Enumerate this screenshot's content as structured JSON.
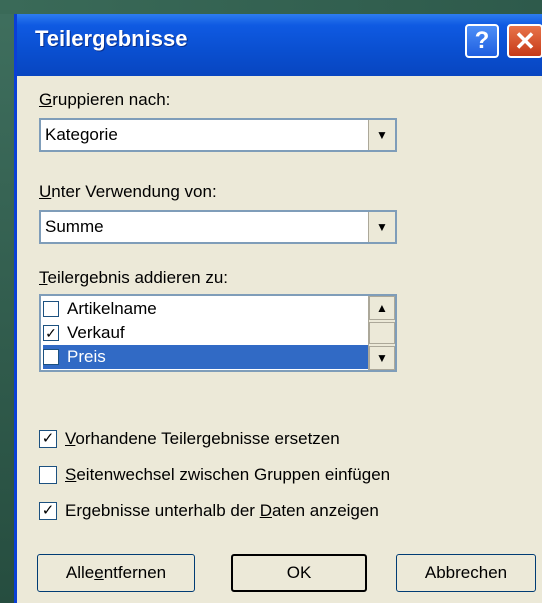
{
  "dialog": {
    "title": "Teilergebnisse",
    "help_label": "?",
    "close_label": "✕"
  },
  "group_by": {
    "label_u": "G",
    "label_rest": "ruppieren nach:",
    "value": "Kategorie"
  },
  "use_function": {
    "label_u": "U",
    "label_rest": "nter Verwendung von:",
    "value": "Summe"
  },
  "add_to": {
    "label_u": "T",
    "label_rest": "eilergebnis addieren zu:",
    "items": [
      {
        "label": "Artikelname",
        "checked": false,
        "mark": ""
      },
      {
        "label": "Verkauf",
        "checked": true,
        "mark": "✓"
      },
      {
        "label": "Preis",
        "checked": false,
        "mark": "",
        "selected": true
      }
    ]
  },
  "options": [
    {
      "u": "V",
      "rest": "orhandene Teilergebnisse ersetzen",
      "checked": true,
      "mark": "✓"
    },
    {
      "u": "S",
      "rest": "eitenwechsel zwischen Gruppen einfügen",
      "checked": false,
      "mark": ""
    },
    {
      "pre": "Ergebnisse unterhalb der ",
      "u": "D",
      "rest": "aten anzeigen",
      "checked": true,
      "mark": "✓"
    }
  ],
  "buttons": {
    "remove_all_pre": "Alle ",
    "remove_all_u": "e",
    "remove_all_rest": "ntfernen",
    "ok": "OK",
    "cancel": "Abbrechen"
  },
  "icons": {
    "dropdown": "triangle-down",
    "scroll_up": "triangle-up",
    "scroll_down": "triangle-down",
    "check": "checkmark"
  },
  "colors": {
    "titlebar": "#0a4fd0",
    "dialog_bg": "#ece9d8",
    "selection": "#316ac5",
    "close_button": "#c63a18"
  }
}
